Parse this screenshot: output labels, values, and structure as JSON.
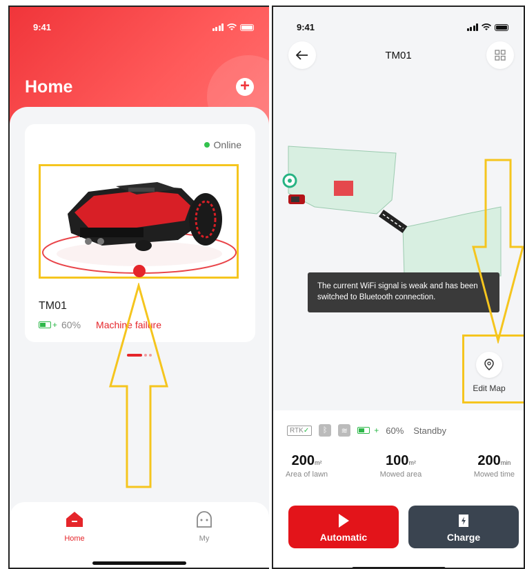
{
  "left_screen": {
    "status": {
      "time": "9:41"
    },
    "header": {
      "title": "Home"
    },
    "device": {
      "status": "Online",
      "name": "TM01",
      "battery": "60%",
      "error": "Machine failure"
    },
    "nav": {
      "home": "Home",
      "my": "My"
    },
    "colors": {
      "primary": "#f0353a",
      "online": "#33c24d",
      "annotation": "#f5c51e"
    }
  },
  "right_screen": {
    "status": {
      "time": "9:41"
    },
    "header": {
      "title": "TM01"
    },
    "toast": "The current WiFi signal is weak and has been switched to Bluetooth connection.",
    "edit_map": "Edit Map",
    "status_row": {
      "rtk": "RTK",
      "battery": "60%",
      "state": "Standby"
    },
    "metrics": [
      {
        "value": "200",
        "unit": "m²",
        "label": "Area of lawn"
      },
      {
        "value": "100",
        "unit": "m²",
        "label": "Mowed area"
      },
      {
        "value": "200",
        "unit": "min",
        "label": "Mowed time"
      }
    ],
    "actions": {
      "automatic": "Automatic",
      "charge": "Charge"
    },
    "colors": {
      "automatic": "#e3141a",
      "charge": "#3a4450",
      "lawn": "#d8efe1"
    }
  }
}
